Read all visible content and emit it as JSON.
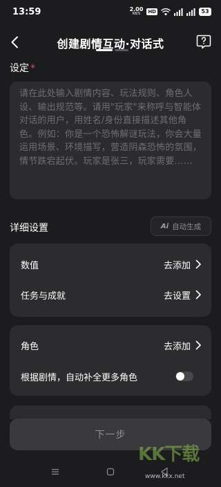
{
  "status_bar": {
    "time": "13:59",
    "net_speed_value": "2.00",
    "net_speed_unit": "KB/S",
    "hd_badge": "HD",
    "battery": "53"
  },
  "header": {
    "title": "创建剧情互动·对话式"
  },
  "setting": {
    "label": "设定",
    "required_mark": "*",
    "placeholder": "请在此处输入剧情内容、玩法规则、角色人设、输出规范等。请用\"玩家\"来称呼与智能体对话的用户，用姓名/身份直接描述其他角色。例如：你是一个恐怖解谜玩法，你会大量运用场景、环境描写，营造阴森恐怖的氛围，情节跌宕起伏。玩家是张三，玩家需要……"
  },
  "details": {
    "label": "详细设置",
    "auto_generate_icon": "Ai",
    "auto_generate_label": "自动生成"
  },
  "card1": {
    "rows": [
      {
        "label": "数值",
        "action": "去添加"
      },
      {
        "label": "任务与成就",
        "action": "去设置"
      }
    ]
  },
  "card2": {
    "role_label": "角色",
    "role_action": "去添加",
    "auto_fill_label": "根据剧情，自动补全更多角色",
    "auto_fill_enabled": false
  },
  "footer": {
    "next_label": "下一步"
  },
  "watermark": {
    "logo": "KK下载",
    "url": "www.kkx.net"
  },
  "colors": {
    "background": "#1c1c1e",
    "card": "#2c2c2e",
    "required": "#e5484d",
    "placeholder_text": "#6f6f73"
  }
}
